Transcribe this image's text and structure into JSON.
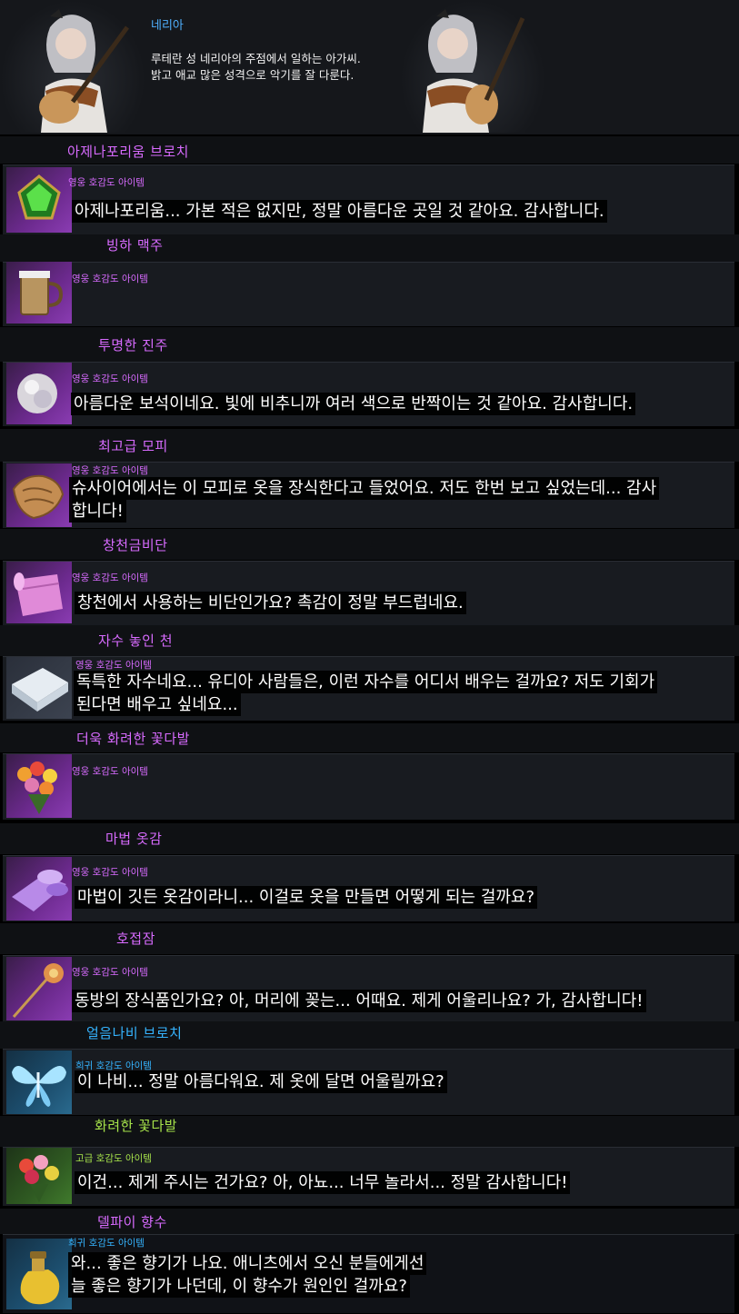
{
  "npc": {
    "name": "네리아",
    "desc_line1": "루테란 성 네리아의 주점에서 일하는 아가씨.",
    "desc_line2": "밝고 애교 많은 성격으로 악기를 잘 다룬다."
  },
  "items": [
    {
      "name": "아제나포리움 브로치",
      "grade": "영웅 호감도 아이템",
      "quote": [
        "아제나포리움... 가본 적은 없지만, 정말 아름다운 곳일 것 같아요. 감사합니다."
      ],
      "icon": "green-gem-brooch-icon"
    },
    {
      "name": "빙하 맥주",
      "grade": "영웅 호감도 아이템",
      "quote": [],
      "icon": "beer-mug-icon"
    },
    {
      "name": "투명한 진주",
      "grade": "영웅 호감도 아이템",
      "quote": [
        "아름다운 보석이네요. 빛에 비추니까 여러 색으로 반짝이는 것 같아요. 감사합니다."
      ],
      "icon": "pearl-icon"
    },
    {
      "name": "최고급 모피",
      "grade": "영웅 호감도 아이템",
      "quote": [
        "슈사이어에서는 이 모피로 옷을 장식한다고 들었어요. 저도 한번 보고 싶었는데... 감사",
        "합니다!"
      ],
      "icon": "fur-icon"
    },
    {
      "name": "창천금비단",
      "grade": "영웅 호감도 아이템",
      "quote": [
        "창천에서 사용하는 비단인가요? 촉감이 정말 부드럽네요."
      ],
      "icon": "silk-scroll-icon"
    },
    {
      "name": "자수 놓인 천",
      "grade": "영웅 호감도 아이템",
      "quote": [
        "독특한 자수네요... 유디아 사람들은, 이런 자수를 어디서 배우는 걸까요? 저도 기회가",
        "된다면 배우고 싶네요..."
      ],
      "icon": "folded-cloth-icon"
    },
    {
      "name": "더욱 화려한 꽃다발",
      "grade": "영웅 호감도 아이템",
      "quote": [],
      "icon": "bouquet-icon"
    },
    {
      "name": "마법 옷감",
      "grade": "영웅 호감도 아이템",
      "quote": [
        "마법이 깃든 옷감이라니... 이걸로 옷을 만들면 어떻게 되는 걸까요?"
      ],
      "icon": "magic-fabric-icon"
    },
    {
      "name": "호접잠",
      "grade": "영웅 호감도 아이템",
      "quote": [
        "동방의 장식품인가요? 아, 머리에 꽂는... 어때요. 제게 어울리나요? 가, 감사합니다!"
      ],
      "icon": "hairpin-icon"
    },
    {
      "name": "얼음나비 브로치",
      "grade": "희귀 호감도 아이템",
      "quote": [
        "이 나비... 정말 아름다워요. 제 옷에 달면 어울릴까요?"
      ],
      "icon": "ice-butterfly-icon"
    },
    {
      "name": "화려한 꽃다발",
      "grade": "고급 호감도 아이템",
      "quote": [
        "이건... 제게 주시는 건가요? 아, 아뇨... 너무 놀라서... 정말 감사합니다!"
      ],
      "icon": "flower-bouquet-icon"
    },
    {
      "name": "델파이 향수",
      "grade": "희귀 호감도 아이템",
      "quote": [
        "와... 좋은 향기가 나요. 애니츠에서 오신 분들에게선",
        "늘 좋은 향기가 나던데, 이 향수가 원인인 걸까요?"
      ],
      "icon": "perfume-bottle-icon"
    }
  ],
  "colors": {
    "hero": "#d86bff",
    "rare": "#35b4ff",
    "advanced": "#a6e24a",
    "npc_name": "#4fb0ff"
  }
}
